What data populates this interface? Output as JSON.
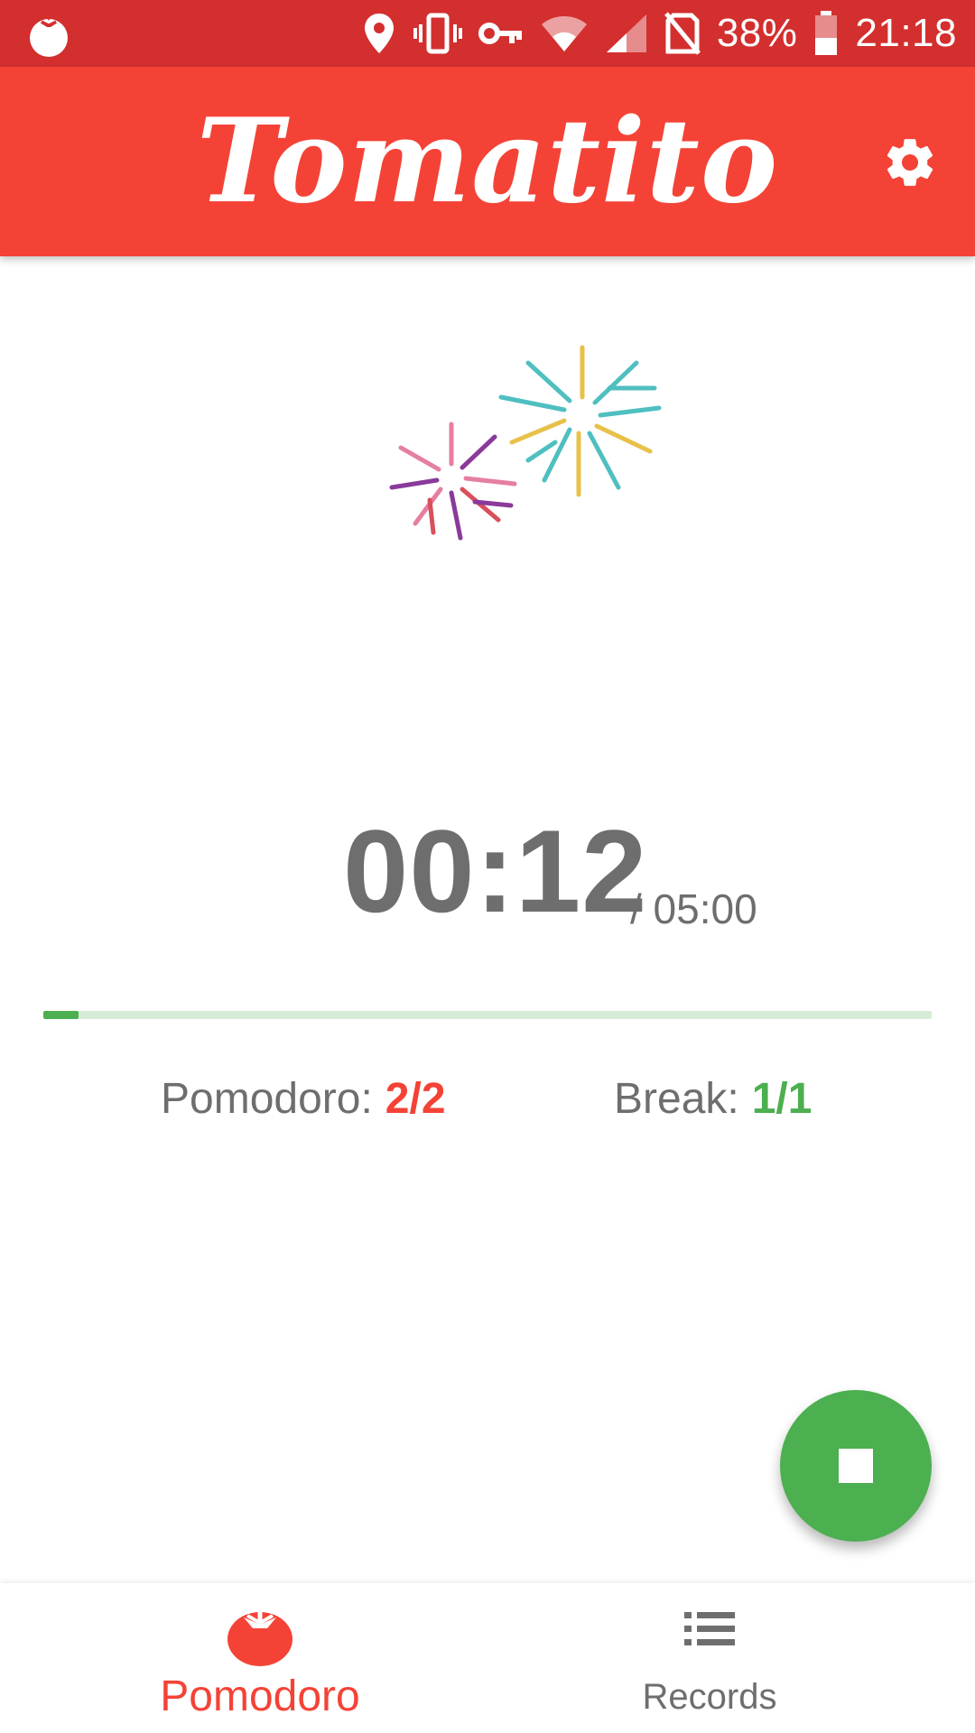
{
  "status_bar": {
    "app_icon": "tomato-icon",
    "icons": [
      "location-icon",
      "vibrate-icon",
      "vpn-key-icon",
      "wifi-icon",
      "signal-icon",
      "no-sim-icon",
      "battery-icon"
    ],
    "battery_percent": "38%",
    "time": "21:18"
  },
  "app_bar": {
    "title": "Tomatito",
    "settings_icon": "gear-icon"
  },
  "celebration": {
    "icon": "fireworks-illustration"
  },
  "timer": {
    "elapsed": "00:12",
    "total": "/ 05:00",
    "progress": 0.04
  },
  "counters": {
    "pomodoro_label": "Pomodoro:",
    "pomodoro_value": "2/2",
    "break_label": "Break:",
    "break_value": "1/1"
  },
  "fab": {
    "icon": "stop-icon"
  },
  "bottom_nav": {
    "items": [
      {
        "label": "Pomodoro",
        "icon": "tomato-icon",
        "active": true
      },
      {
        "label": "Records",
        "icon": "list-icon",
        "active": false
      }
    ]
  },
  "colors": {
    "status_bar": "#d32f2f",
    "app_bar": "#f44336",
    "accent_green": "#4caf50",
    "accent_red": "#f44336",
    "text_gray": "#6e6e6e"
  }
}
